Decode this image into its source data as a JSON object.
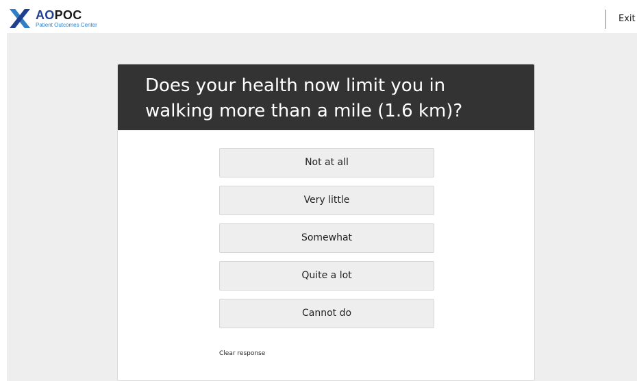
{
  "brand": {
    "title_ao": "AO",
    "title_poc": "POC",
    "subtitle": "Patient Outcomes Center",
    "logo_icon": "x-cross-logo-icon"
  },
  "header": {
    "exit_label": "Exit"
  },
  "question": {
    "text": "Does your health now limit you in walking more than a mile (1.6 km)?"
  },
  "options": [
    {
      "label": "Not at all"
    },
    {
      "label": "Very little"
    },
    {
      "label": "Somewhat"
    },
    {
      "label": "Quite a lot"
    },
    {
      "label": "Cannot do"
    }
  ],
  "clear_label": "Clear response",
  "colors": {
    "header_bg": "#333333",
    "page_bg": "#eeeeee",
    "brand_blue": "#1f3f8f",
    "brand_light_blue": "#2f7fc6"
  }
}
